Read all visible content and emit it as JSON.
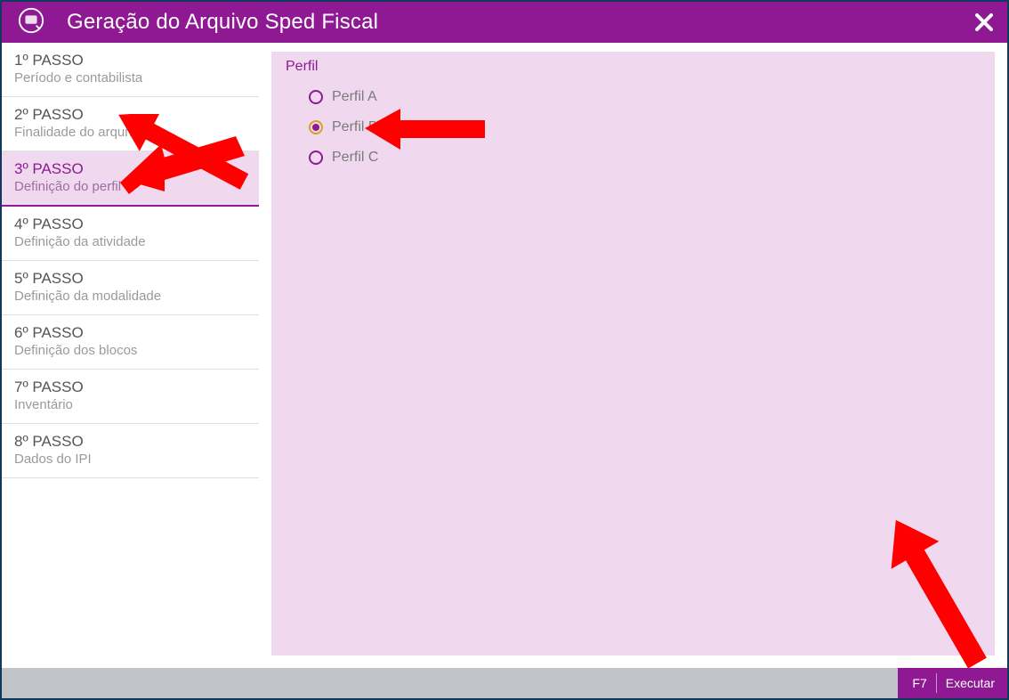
{
  "window": {
    "title": "Geração do Arquivo Sped Fiscal"
  },
  "steps": [
    {
      "num": "1º PASSO",
      "desc": "Período e contabilista"
    },
    {
      "num": "2º PASSO",
      "desc": "Finalidade do arquivo"
    },
    {
      "num": "3º PASSO",
      "desc": "Definição do perfil"
    },
    {
      "num": "4º PASSO",
      "desc": "Definição da atividade"
    },
    {
      "num": "5º PASSO",
      "desc": "Definição da modalidade"
    },
    {
      "num": "6º PASSO",
      "desc": "Definição dos blocos"
    },
    {
      "num": "7º PASSO",
      "desc": "Inventário"
    },
    {
      "num": "8º PASSO",
      "desc": "Dados do IPI"
    }
  ],
  "active_step_index": 2,
  "group": {
    "label": "Perfil",
    "options": [
      {
        "label": "Perfil A"
      },
      {
        "label": "Perfil B"
      },
      {
        "label": "Perfil C"
      }
    ],
    "selected_index": 1
  },
  "footer": {
    "shortcut": "F7",
    "button": "Executar"
  }
}
